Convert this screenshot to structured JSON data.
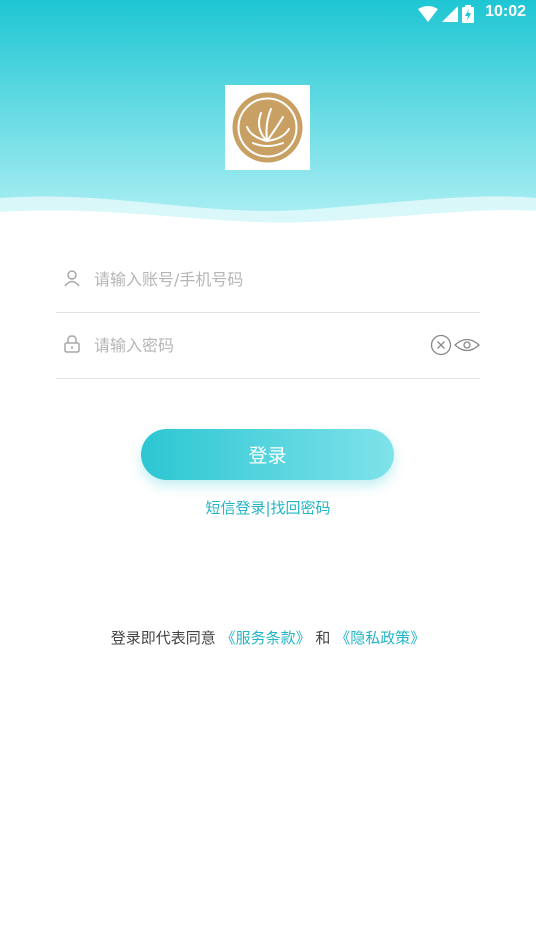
{
  "status_bar": {
    "time": "10:02"
  },
  "colors": {
    "accent": "#23b5c6",
    "header_top": "#1ec6d3",
    "header_bottom": "#aef0f4",
    "logo_gold": "#c9a063"
  },
  "login_form": {
    "account_placeholder": "请输入账号/手机号码",
    "password_placeholder": "请输入密码",
    "login_label": "登录"
  },
  "links": {
    "sms_login": "短信登录",
    "separator": "|",
    "find_password": "找回密码"
  },
  "agreement": {
    "prefix": "登录即代表同意",
    "terms": "《服务条款》",
    "conjunction": "和",
    "privacy": "《隐私政策》"
  }
}
